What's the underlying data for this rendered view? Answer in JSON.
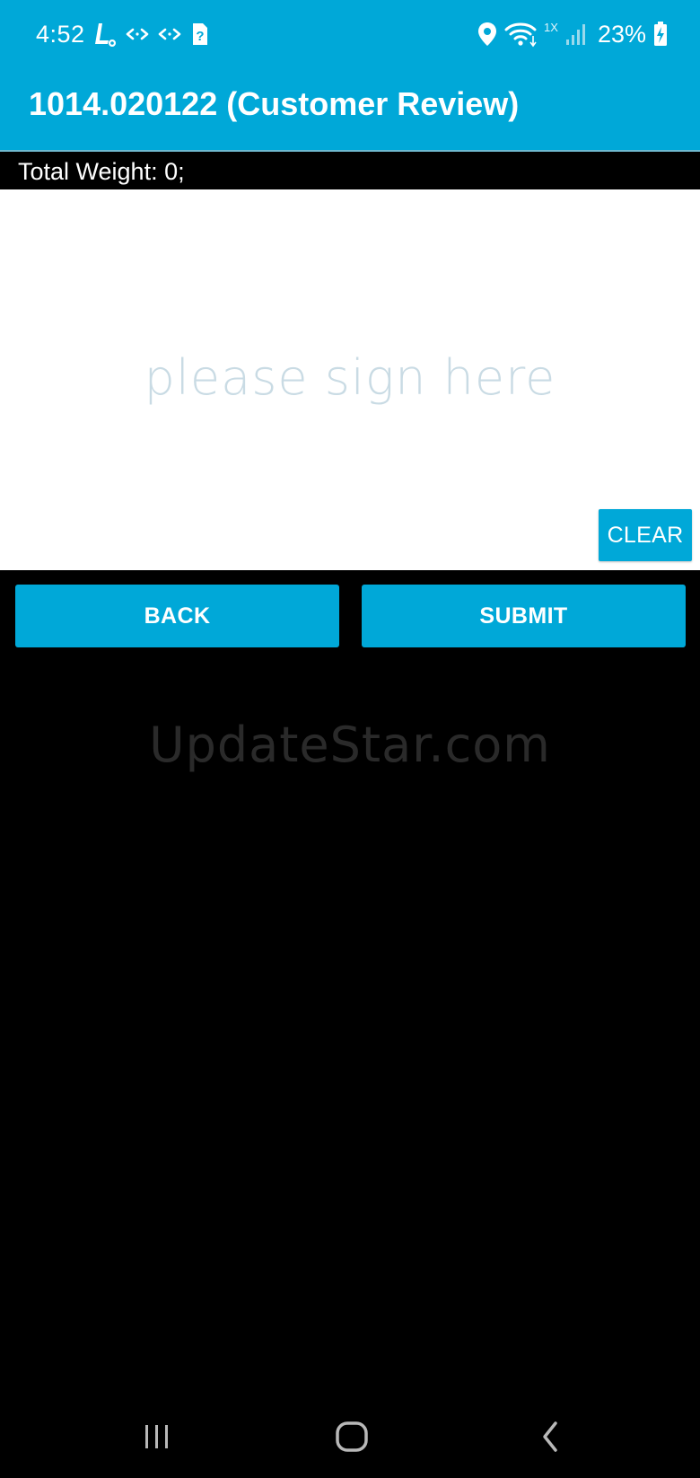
{
  "status_bar": {
    "time": "4:52",
    "battery": "23%",
    "network_label": "1X",
    "left_icons": [
      "l-app-icon",
      "data-sync-icon",
      "data-sync-icon",
      "sim-unknown-icon"
    ],
    "right_icons": [
      "location-icon",
      "wifi-icon",
      "signal-icon",
      "battery-charging-icon"
    ]
  },
  "app_bar": {
    "title": "1014.020122 (Customer Review)"
  },
  "summary": {
    "total_weight": "Total Weight: 0;"
  },
  "signature_pad": {
    "placeholder": "please sign here",
    "clear_label": "CLEAR"
  },
  "actions": {
    "back_label": "BACK",
    "submit_label": "SUBMIT"
  },
  "watermark": "UpdateStar.com",
  "nav_bar": {
    "icons": [
      "recent-apps-icon",
      "home-icon",
      "back-icon"
    ]
  },
  "colors": {
    "accent": "#00a8d8",
    "background": "#000000",
    "pad_background": "#ffffff",
    "placeholder_text": "#c9dbe4"
  }
}
